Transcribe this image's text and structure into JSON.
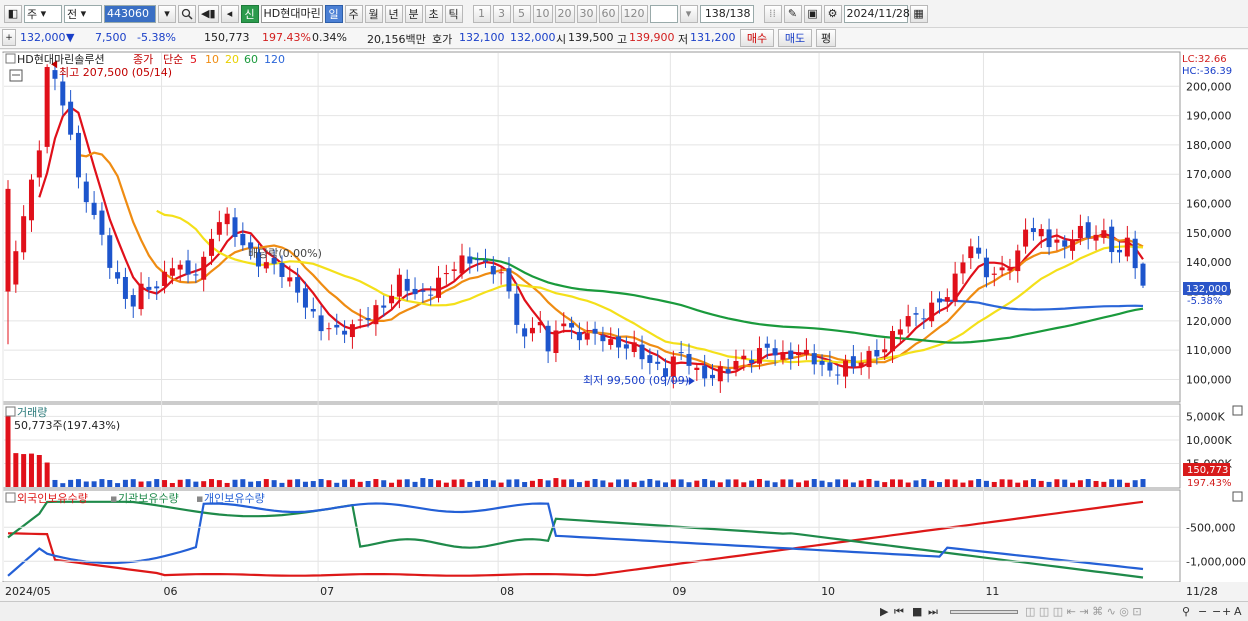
{
  "toolbar": {
    "type_label": "주",
    "market_label": "전",
    "stock_code": "443060",
    "new_badge": "신",
    "stock_name": "HD현대마린",
    "periods": [
      "일",
      "주",
      "월",
      "년",
      "분",
      "초",
      "틱"
    ],
    "active_period": "일",
    "intervals": [
      "1",
      "3",
      "5",
      "10",
      "20",
      "30",
      "60",
      "120"
    ],
    "count_value": "138",
    "count_total": "/138",
    "date_value": "2024/11/28"
  },
  "quote": {
    "price": "132,000",
    "change_arrow": "▼",
    "change": "7,500",
    "change_pct": "-5.38%",
    "volume": "150,773",
    "volume_ratio": "197.43%",
    "turnover": "0.34%",
    "amount": "20,156백만",
    "hoga_label": "호가",
    "ask": "132,100",
    "bid": "132,000",
    "open_label": "시",
    "open": "139,500",
    "high_label": "고",
    "high": "139,900",
    "low_label": "저",
    "low": "131,200",
    "buy_label": "매수",
    "sell_label": "매도",
    "eval_label": "평"
  },
  "colors": {
    "up": "#e0101a",
    "down": "#1d55cc",
    "ma5": "#e0101a",
    "ma10": "#ef8c12",
    "ma20": "#f4e01a",
    "ma60": "#1a9a3c",
    "ma120": "#2b66d8",
    "foreign": "#dd1818",
    "inst": "#1f8a4a",
    "indiv": "#2460d6"
  },
  "chart_data": [
    {
      "type": "candlestick",
      "title": "HD현대마린솔루션",
      "legend": {
        "price_label": "종가",
        "ma_label": "단순",
        "ma_periods": [
          "5",
          "10",
          "20",
          "60",
          "120"
        ]
      },
      "y_ticks": [
        "100,000",
        "110,000",
        "120,000",
        "130,000",
        "140,000",
        "150,000",
        "160,000",
        "170,000",
        "180,000",
        "190,000",
        "200,000"
      ],
      "ylim": [
        93000,
        211000
      ],
      "x_ticks": [
        {
          "label": "2024/05",
          "idx": 0
        },
        {
          "label": "06",
          "idx": 20
        },
        {
          "label": "07",
          "idx": 40
        },
        {
          "label": "08",
          "idx": 63
        },
        {
          "label": "09",
          "idx": 85
        },
        {
          "label": "10",
          "idx": 104
        },
        {
          "label": "11",
          "idx": 125
        },
        {
          "label": "11/28",
          "idx": 145
        }
      ],
      "anchors": [
        [
          0,
          130000
        ],
        [
          1,
          142000
        ],
        [
          2,
          158000
        ],
        [
          4,
          178000
        ],
        [
          5,
          207500
        ],
        [
          6,
          200000
        ],
        [
          7,
          194000
        ],
        [
          8,
          185000
        ],
        [
          9,
          168000
        ],
        [
          10,
          162000
        ],
        [
          11,
          155000
        ],
        [
          13,
          140000
        ],
        [
          15,
          128000
        ],
        [
          16,
          126000
        ],
        [
          17,
          130000
        ],
        [
          19,
          132000
        ],
        [
          20,
          136000
        ],
        [
          21,
          140000
        ],
        [
          22,
          138000
        ],
        [
          23,
          134000
        ],
        [
          24,
          137000
        ],
        [
          25,
          141000
        ],
        [
          26,
          149000
        ],
        [
          27,
          155000
        ],
        [
          28,
          154000
        ],
        [
          29,
          149000
        ],
        [
          30,
          146000
        ],
        [
          31,
          144000
        ],
        [
          32,
          141000
        ],
        [
          33,
          139000
        ],
        [
          34,
          138000
        ],
        [
          35,
          136000
        ],
        [
          37,
          131000
        ],
        [
          38,
          126000
        ],
        [
          39,
          121000
        ],
        [
          40,
          117000
        ],
        [
          42,
          117000
        ],
        [
          43,
          118000
        ],
        [
          44,
          118000
        ],
        [
          46,
          121000
        ],
        [
          48,
          126000
        ],
        [
          50,
          134000
        ],
        [
          51,
          131000
        ],
        [
          52,
          128000
        ],
        [
          53,
          129000
        ],
        [
          55,
          134000
        ],
        [
          57,
          138000
        ],
        [
          58,
          140000
        ],
        [
          60,
          142000
        ],
        [
          61,
          139000
        ],
        [
          62,
          137000
        ],
        [
          63,
          135000
        ],
        [
          64,
          129000
        ],
        [
          65,
          121000
        ],
        [
          66,
          114000
        ],
        [
          67,
          118000
        ],
        [
          68,
          120000
        ],
        [
          69,
          107000
        ],
        [
          70,
          118000
        ],
        [
          71,
          120000
        ],
        [
          72,
          117000
        ],
        [
          73,
          115000
        ],
        [
          74,
          114000
        ],
        [
          76,
          115000
        ],
        [
          77,
          113000
        ],
        [
          78,
          112000
        ],
        [
          79,
          111000
        ],
        [
          80,
          110000
        ],
        [
          81,
          108000
        ],
        [
          82,
          106000
        ],
        [
          83,
          105000
        ],
        [
          84,
          103000
        ],
        [
          85,
          106000
        ],
        [
          86,
          108000
        ],
        [
          87,
          106000
        ],
        [
          88,
          103000
        ],
        [
          89,
          102000
        ],
        [
          90,
          101000
        ],
        [
          91,
          102000
        ],
        [
          92,
          103000
        ],
        [
          93,
          106000
        ],
        [
          94,
          108000
        ],
        [
          95,
          108000
        ],
        [
          97,
          110000
        ],
        [
          98,
          109000
        ],
        [
          99,
          108000
        ],
        [
          100,
          109000
        ],
        [
          101,
          110000
        ],
        [
          102,
          108000
        ],
        [
          103,
          106000
        ],
        [
          104,
          104000
        ],
        [
          105,
          103000
        ],
        [
          106,
          104000
        ],
        [
          107,
          105000
        ],
        [
          108,
          104000
        ],
        [
          109,
          106000
        ],
        [
          110,
          108000
        ],
        [
          111,
          110000
        ],
        [
          112,
          111000
        ],
        [
          113,
          115000
        ],
        [
          114,
          118000
        ],
        [
          115,
          120000
        ],
        [
          116,
          122000
        ],
        [
          117,
          123000
        ],
        [
          118,
          125000
        ],
        [
          120,
          128000
        ],
        [
          121,
          134000
        ],
        [
          122,
          142000
        ],
        [
          123,
          146000
        ],
        [
          124,
          142000
        ],
        [
          125,
          136000
        ],
        [
          126,
          134000
        ],
        [
          127,
          138000
        ],
        [
          128,
          140000
        ],
        [
          129,
          143000
        ],
        [
          130,
          152000
        ],
        [
          131,
          150000
        ],
        [
          132,
          149000
        ],
        [
          133,
          147000
        ],
        [
          134,
          148000
        ],
        [
          135,
          145000
        ],
        [
          136,
          149000
        ],
        [
          137,
          150000
        ],
        [
          138,
          148000
        ],
        [
          139,
          151000
        ],
        [
          140,
          150000
        ],
        [
          141,
          145000
        ],
        [
          142,
          143000
        ],
        [
          143,
          146000
        ],
        [
          144,
          139500
        ],
        [
          145,
          132000
        ]
      ],
      "high_annotation": "최고 207,500 (05/14)",
      "low_annotation": "최저 99,500 (09/09)",
      "dividend_annotation": "배당락(0.00%)",
      "right_labels": {
        "lc": "LC:32.66",
        "hc": "HC:-36.39",
        "price": "132,000",
        "pct": "-5.38%"
      }
    },
    {
      "type": "bar",
      "title": "거래량",
      "value_label": "50,773주(197.43%)",
      "y_ticks": [
        "5,000K",
        "10,000K",
        "15,000K"
      ],
      "last_volume": "150,773",
      "last_pct": "197.43%"
    },
    {
      "type": "line",
      "series_names": [
        "외국인보유수량",
        "기관보유수량",
        "개인보유수량"
      ],
      "y_ticks": [
        "-500,000",
        "-1,000,000"
      ]
    }
  ],
  "status_icons": [
    "play-icon",
    "first-icon",
    "stop-icon",
    "last-icon",
    "zoom-out-icon",
    "zoom-in-icon",
    "text-icon"
  ]
}
